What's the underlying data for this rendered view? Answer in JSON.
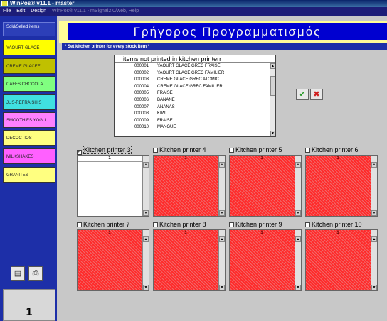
{
  "window": {
    "title": "WinPos® v11.1 - master"
  },
  "menu": {
    "items": [
      "File",
      "Edit",
      "Design",
      "WinPos® v11.1 - mSignal2.0/web, Help"
    ]
  },
  "sidebar": {
    "header": "Sold/Selled items",
    "categories": [
      {
        "label": "YAOURT GLACE",
        "color": "#ffff00"
      },
      {
        "label": "CREME GLACEE",
        "color": "#c0c000"
      },
      {
        "label": "CAFES CHOCOLA",
        "color": "#80ff80"
      },
      {
        "label": "JUS-REFRAISHIS",
        "color": "#40e0e0"
      },
      {
        "label": "SMOOTHIES YOGU",
        "color": "#ff80ff"
      },
      {
        "label": "DECOCTIOS",
        "color": "#ffff80"
      },
      {
        "label": "MILKSHAKES",
        "color": "#ff60ff"
      },
      {
        "label": "GRANITES",
        "color": "#ffff80"
      }
    ],
    "counter": "1"
  },
  "header": {
    "title": "Γρήγορος Προγραμματισμός"
  },
  "section": {
    "label": "* Set kitchen printer for every stock item *"
  },
  "item_list": {
    "header": "items not printed in kitchen printerr",
    "rows": [
      {
        "code": "000001",
        "name": "YAOURT GLACE GREC FRAISE"
      },
      {
        "code": "000002",
        "name": "YAOURT GLACE GREC FAMILIER"
      },
      {
        "code": "000003",
        "name": "CREME GLACE GREC ATOMIC"
      },
      {
        "code": "000004",
        "name": "CREME GLACE GREC FAMILIER"
      },
      {
        "code": "000005",
        "name": "FRAISE"
      },
      {
        "code": "000006",
        "name": "BANANE"
      },
      {
        "code": "000007",
        "name": "ANANAS"
      },
      {
        "code": "000008",
        "name": "KIWI"
      },
      {
        "code": "000009",
        "name": "FRAISE"
      },
      {
        "code": "000010",
        "name": "MANGUE"
      }
    ]
  },
  "actions": {
    "ok_icon": "checkmark-icon",
    "cancel_icon": "x-icon"
  },
  "printers": [
    {
      "label": "Kitchen printer 3",
      "checked": true,
      "header": "1"
    },
    {
      "label": "Kitchen printer 4",
      "checked": false,
      "header": "1"
    },
    {
      "label": "Kitchen printer 5",
      "checked": false,
      "header": "1"
    },
    {
      "label": "Kitchen printer 6",
      "checked": false,
      "header": "1"
    },
    {
      "label": "Kitchen printer 7",
      "checked": false,
      "header": "1"
    },
    {
      "label": "Kitchen printer 8",
      "checked": false,
      "header": "1"
    },
    {
      "label": "Kitchen printer 9",
      "checked": false,
      "header": "1"
    },
    {
      "label": "Kitchen printer 10",
      "checked": false,
      "header": "1"
    }
  ]
}
